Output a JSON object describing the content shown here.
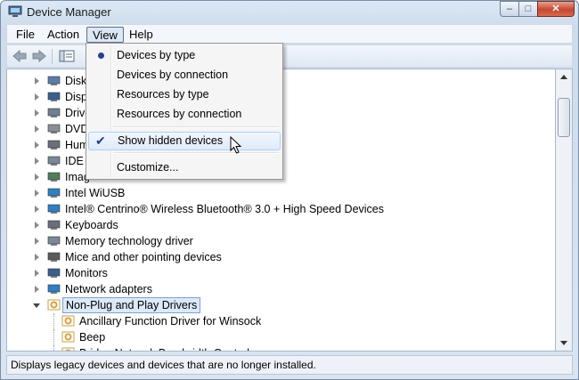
{
  "window": {
    "title": "Device Manager"
  },
  "menubar": {
    "items": [
      "File",
      "Action",
      "View",
      "Help"
    ],
    "active": "View"
  },
  "tree": {
    "rows": [
      {
        "label": "Disk"
      },
      {
        "label": "Disp"
      },
      {
        "label": "Drive"
      },
      {
        "label": "DVD"
      },
      {
        "label": "Hum"
      },
      {
        "label": "IDE A"
      },
      {
        "label": "Imag"
      },
      {
        "label": "Intel WiUSB"
      },
      {
        "label": "Intel® Centrino® Wireless Bluetooth® 3.0 + High Speed Devices"
      },
      {
        "label": "Keyboards"
      },
      {
        "label": "Memory technology driver"
      },
      {
        "label": "Mice and other pointing devices"
      },
      {
        "label": "Monitors"
      },
      {
        "label": "Network adapters"
      },
      {
        "label": "Non-Plug and Play Drivers"
      },
      {
        "label": "Ancillary Function Driver for Winsock"
      },
      {
        "label": "Beep"
      },
      {
        "label": "Bridge Network Bandwidth Control"
      }
    ]
  },
  "view_menu": {
    "items": [
      {
        "label": "Devices by type",
        "mark": "radio"
      },
      {
        "label": "Devices by connection",
        "mark": ""
      },
      {
        "label": "Resources by type",
        "mark": ""
      },
      {
        "label": "Resources by connection",
        "mark": ""
      },
      {
        "label": "Show hidden devices",
        "mark": "check"
      },
      {
        "label": "Customize...",
        "mark": ""
      }
    ]
  },
  "statusbar": {
    "text": "Displays legacy devices and devices that are no longer installed."
  },
  "colors": {
    "selection": "#dbe9f9",
    "accent": "#2b3f8f",
    "close": "#c7462f"
  }
}
